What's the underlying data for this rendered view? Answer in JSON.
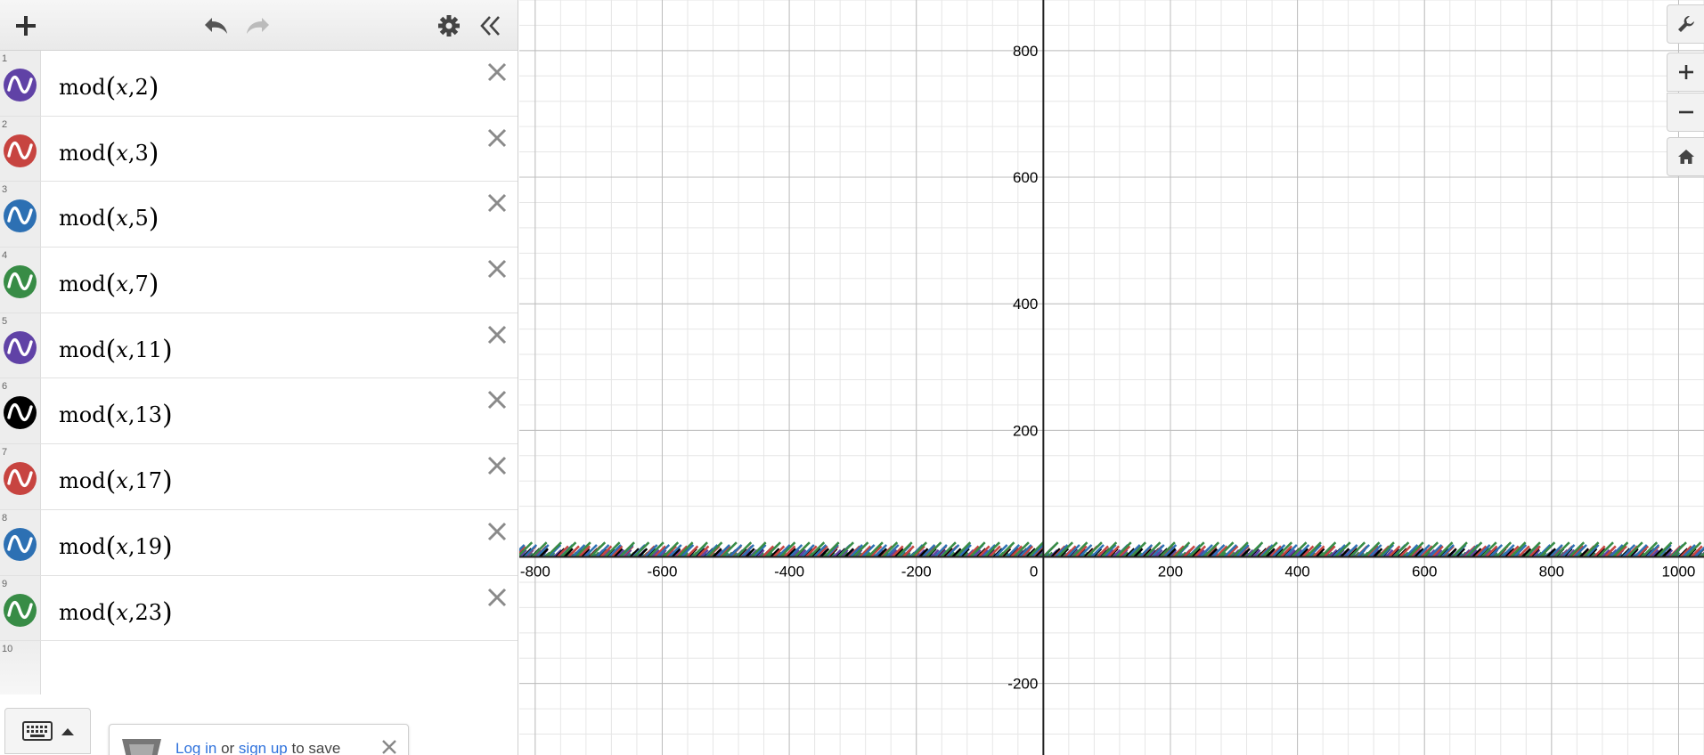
{
  "toolbar": {
    "add_icon": "plus-icon",
    "undo_icon": "undo-icon",
    "redo_icon": "redo-icon",
    "settings_icon": "gear-icon",
    "collapse_icon": "double-chevron-left-icon"
  },
  "expressions": [
    {
      "index": "1",
      "func": "mod",
      "var": "x",
      "arg": "2",
      "color": "#6042a6"
    },
    {
      "index": "2",
      "func": "mod",
      "var": "x",
      "arg": "3",
      "color": "#c74440"
    },
    {
      "index": "3",
      "func": "mod",
      "var": "x",
      "arg": "5",
      "color": "#2d70b3"
    },
    {
      "index": "4",
      "func": "mod",
      "var": "x",
      "arg": "7",
      "color": "#388c46"
    },
    {
      "index": "5",
      "func": "mod",
      "var": "x",
      "arg": "11",
      "color": "#6042a6"
    },
    {
      "index": "6",
      "func": "mod",
      "var": "x",
      "arg": "13",
      "color": "#000000"
    },
    {
      "index": "7",
      "func": "mod",
      "var": "x",
      "arg": "17",
      "color": "#c74440"
    },
    {
      "index": "8",
      "func": "mod",
      "var": "x",
      "arg": "19",
      "color": "#2d70b3"
    },
    {
      "index": "9",
      "func": "mod",
      "var": "x",
      "arg": "23",
      "color": "#388c46"
    }
  ],
  "empty_row_index": "10",
  "save_toast": {
    "login": "Log in",
    "or": "or",
    "signup": "sign up",
    "suffix": "to save"
  },
  "graph": {
    "x_range": [
      -825,
      1040
    ],
    "y_range": [
      -313,
      880
    ],
    "x_ticks": [
      "-800",
      "-600",
      "-400",
      "-200",
      "0",
      "200",
      "400",
      "600",
      "800",
      "1000"
    ],
    "y_ticks": [
      "800",
      "600",
      "400",
      "200",
      "-200"
    ]
  },
  "graph_controls": {
    "settings_icon": "wrench-icon",
    "zoom_in_icon": "plus-icon",
    "zoom_out_icon": "minus-icon",
    "home_icon": "home-icon"
  }
}
